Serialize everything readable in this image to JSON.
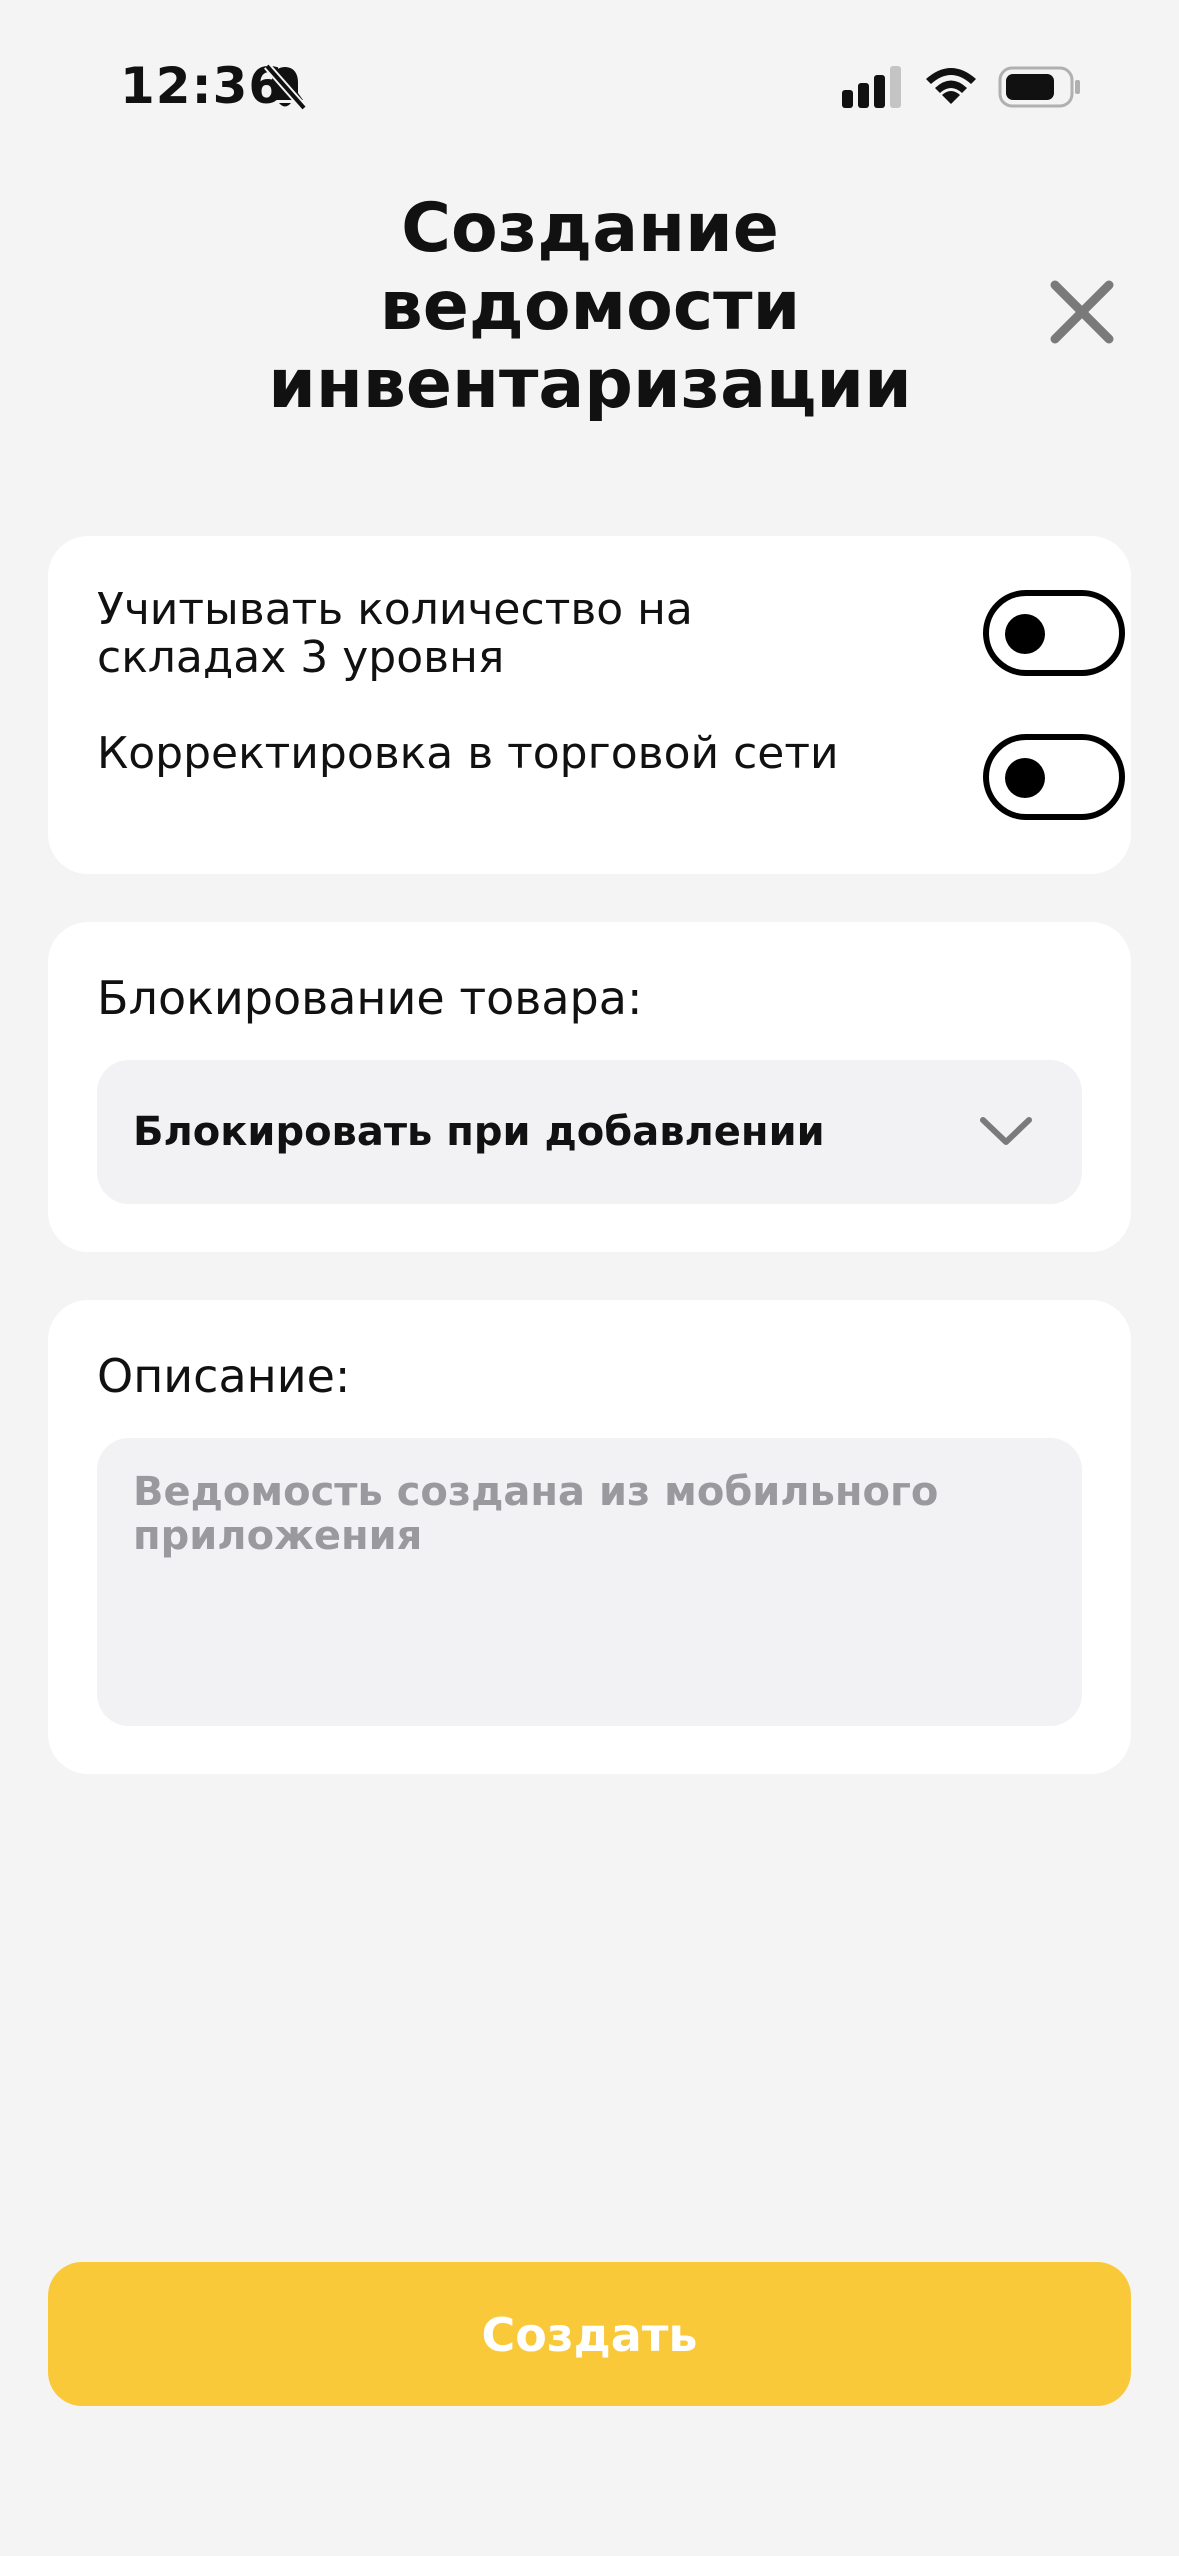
{
  "status_bar": {
    "time": "12:36",
    "icons": [
      "bell-off-icon",
      "signal-icon",
      "wifi-icon",
      "battery-icon"
    ]
  },
  "header": {
    "title": "Создание ведомости инвентаризации",
    "close_icon": "close-icon"
  },
  "toggles": [
    {
      "label": "Учитывать количество на складах 3 уровня",
      "enabled": false
    },
    {
      "label": "Корректировка в торговой сети",
      "enabled": false
    }
  ],
  "blocking": {
    "label": "Блокирование товара:",
    "selected_value": "Блокировать при добавлении",
    "icon": "chevron-down-icon"
  },
  "description": {
    "label": "Описание:",
    "placeholder": "Ведомость создана из мобильного приложения"
  },
  "actions": {
    "create_label": "Создать"
  },
  "colors": {
    "background": "#f4f4f4",
    "card": "#ffffff",
    "field": "#f2f2f4",
    "accent": "#f9c93a",
    "placeholder": "#9a9a9e",
    "close_icon": "#7a7a7a"
  }
}
